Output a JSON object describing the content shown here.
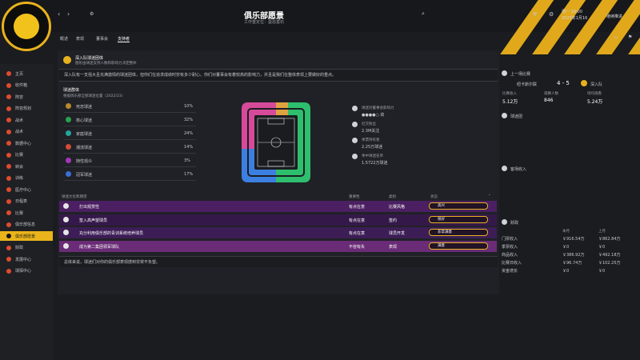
{
  "header": {
    "title": "俱乐部愿景",
    "subtitle": "工作重定位：曼恩基石",
    "date_line1": "周一 10:00",
    "date_line2": "2023年1月16",
    "continue_label": "继续推进"
  },
  "tabs": [
    "概述",
    "表现",
    "董事会",
    "支持者"
  ],
  "sidebar": {
    "items": [
      "主页",
      "收件箱",
      "阵容",
      "阵容规划",
      "战术",
      "战术",
      "数据中心",
      "比赛",
      "转会",
      "训练",
      "医疗中心",
      "日程表",
      "比赛",
      "俱乐部信息",
      "俱乐部愿景",
      "财政",
      "发展中心",
      "球探中心"
    ],
    "active_index": 14
  },
  "intro": {
    "heading": "深入队球迷团体",
    "subheading": "图形由球迷支持人数和影响力决定整体",
    "description": "深入队有一支强大且充满激情的球迷团体，但你们在追求成绩时穷有多少耐心。你们对董事会有着较高的影响力，并且是我们在整体表现上要做好的重点。"
  },
  "fan_groups": {
    "section_title": "球迷群体",
    "season_label": "根据俱乐部全部球迷位置（2022/23）",
    "items": [
      {
        "name": "死忠球迷",
        "percent": "10%",
        "color": "#b88b2a"
      },
      {
        "name": "核心球迷",
        "percent": "32%",
        "color": "#26a44c"
      },
      {
        "name": "家庭球迷",
        "percent": "24%",
        "color": "#25a5a0"
      },
      {
        "name": "潮流球迷",
        "percent": "14%",
        "color": "#d04c35"
      },
      {
        "name": "随性观众",
        "percent": "3%",
        "color": "#a236b9"
      },
      {
        "name": "冠军球迷",
        "percent": "17%",
        "color": "#3b6ed6"
      }
    ]
  },
  "fan_stats": [
    {
      "label": "球迷对董事会影响力",
      "value": "●●●●○ 高"
    },
    {
      "label": "社交粉丝",
      "value": "2.3M关注"
    },
    {
      "label": "季票持有者",
      "value": "2.25万球迷"
    },
    {
      "label": "季中球迷名单",
      "value": "1.5722万球迷"
    }
  ],
  "expectations": {
    "section_title": "球迷文化和期望",
    "col_importance": "重要性",
    "col_category": "类别",
    "col_status": "状态",
    "rows": [
      {
        "title": "打出观赏性",
        "importance": "有点在意",
        "category": "比赛风格",
        "status": "高兴",
        "color": "#4b1f62"
      },
      {
        "title": "签入高声望球员",
        "importance": "有点在意",
        "category": "签约",
        "status": "很好",
        "color": "#35184a"
      },
      {
        "title": "充分利用俱乐部的青训系统培养球员",
        "importance": "有点在意",
        "category": "球员开发",
        "status": "非常满意",
        "color": "#3c1d56"
      },
      {
        "title": "成为第二集团领军球队",
        "importance": "不容有失",
        "category": "表现",
        "status": "满意",
        "color": "#6a2c76"
      }
    ],
    "summary": "总体来说，球迷们对你的俱乐部表现感到非常不负望。"
  },
  "last_match": {
    "title": "上一场比赛",
    "home": "纽卡斯尔联",
    "score": "4 - 5",
    "away": "深入队",
    "col1": "比赛收入",
    "col2": "观赛人数",
    "col3": "场均观看",
    "v1": "5.12万",
    "v2": "846",
    "v3": "5.24万"
  },
  "panels": {
    "fan_room": "球迷团",
    "away_fans": "客场收入",
    "finance": "财政"
  },
  "finance": {
    "col_this": "本月",
    "col_last": "上月",
    "rows": [
      {
        "label": "门票收入",
        "this": "￥916.54万",
        "last": "￥862.84万"
      },
      {
        "label": "季票收入",
        "this": "￥0",
        "last": "￥0"
      },
      {
        "label": "商品收入",
        "this": "￥386.92万",
        "last": "￥492.18万"
      },
      {
        "label": "比赛日收入",
        "this": "￥96.74万",
        "last": "￥102.25万"
      },
      {
        "label": "资金增长",
        "this": "￥0",
        "last": "￥0"
      }
    ]
  }
}
